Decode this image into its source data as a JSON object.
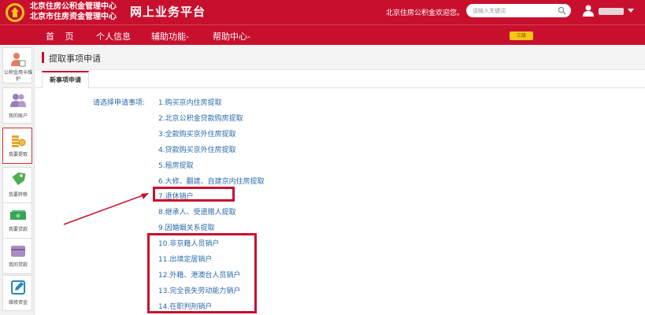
{
  "header": {
    "org_line1": "北京住房公积金管理中心",
    "org_line2": "北京市住房资金管理中心",
    "platform_title": "网上业务平台",
    "welcome_text": "北京住房公积金欢迎您。",
    "search_placeholder": "请输入关键词",
    "badge_text": "三级"
  },
  "nav": {
    "items": [
      {
        "label": "首 页"
      },
      {
        "label": "个人信息"
      },
      {
        "label": "辅助功能-"
      },
      {
        "label": "帮助中心-"
      }
    ]
  },
  "sidebar": {
    "items": [
      {
        "label": "公积金用卡维护",
        "icon": "person-card-icon"
      },
      {
        "label": "我的账户",
        "icon": "users-icon"
      },
      {
        "label": "我要提取",
        "icon": "coins-icon",
        "active": true
      },
      {
        "label": "我要转移",
        "icon": "tag-icon"
      },
      {
        "label": "我要贷款",
        "icon": "money-icon"
      },
      {
        "label": "我的贷款",
        "icon": "wallet-icon"
      },
      {
        "label": "维修资金",
        "icon": "edit-icon"
      }
    ]
  },
  "page": {
    "title": "提取事项申请",
    "tab_label": "新事项申请",
    "prompt": "请选择申请事项:"
  },
  "options": [
    "1.购买京内住房提取",
    "2.北京公积金贷款购房提取",
    "3.全款购买京外住房提取",
    "4.贷款购买京外住房提取",
    "5.租房提取",
    "6.大修、翻建、自建京内住房提取",
    "7.退休销户",
    "8.继承人、受遗赠人提取",
    "9.因婚姻关系提取",
    "10.非京籍人员销户",
    "11.出境定居销户",
    "12.外籍、港澳台人员销户",
    "13.完全丧失劳动能力销户",
    "14.在职判刑销户"
  ],
  "colors": {
    "brand_red": "#c8102e",
    "link_blue": "#2a6aa8",
    "badge_yellow": "#f5c518"
  }
}
